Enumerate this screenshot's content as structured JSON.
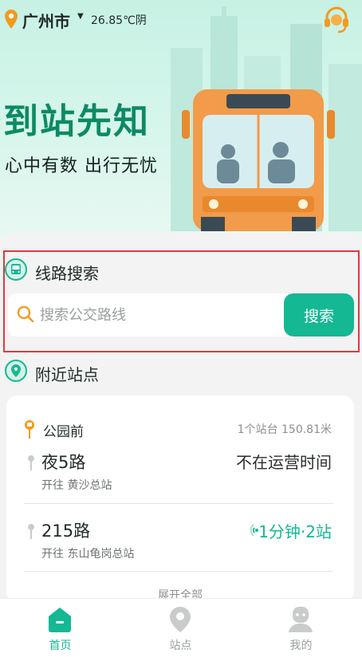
{
  "topbar": {
    "city": "广州市",
    "weather": "26.85℃阴"
  },
  "hero": {
    "title": "到站先知",
    "subtitle": "心中有数 出行无忧"
  },
  "route_search": {
    "title": "线路搜索",
    "placeholder": "搜索公交路线",
    "button_label": "搜索"
  },
  "nearby": {
    "title": "附近站点",
    "stop_name": "公园前",
    "stop_info": "1个站台 150.81米",
    "routes": [
      {
        "name": "夜5路",
        "direction": "开往 黄沙总站",
        "status": "不在运营时间"
      },
      {
        "name": "215路",
        "direction": "开往 东山龟岗总站",
        "eta": "1分钟·2站"
      }
    ],
    "expand_label": "展开全部"
  },
  "tabbar": {
    "items": [
      {
        "label": "首页"
      },
      {
        "label": "站点"
      },
      {
        "label": "我的"
      }
    ]
  },
  "colors": {
    "accent": "#14B893",
    "highlight_border": "#E0393E",
    "pin_orange": "#F29B1D"
  }
}
